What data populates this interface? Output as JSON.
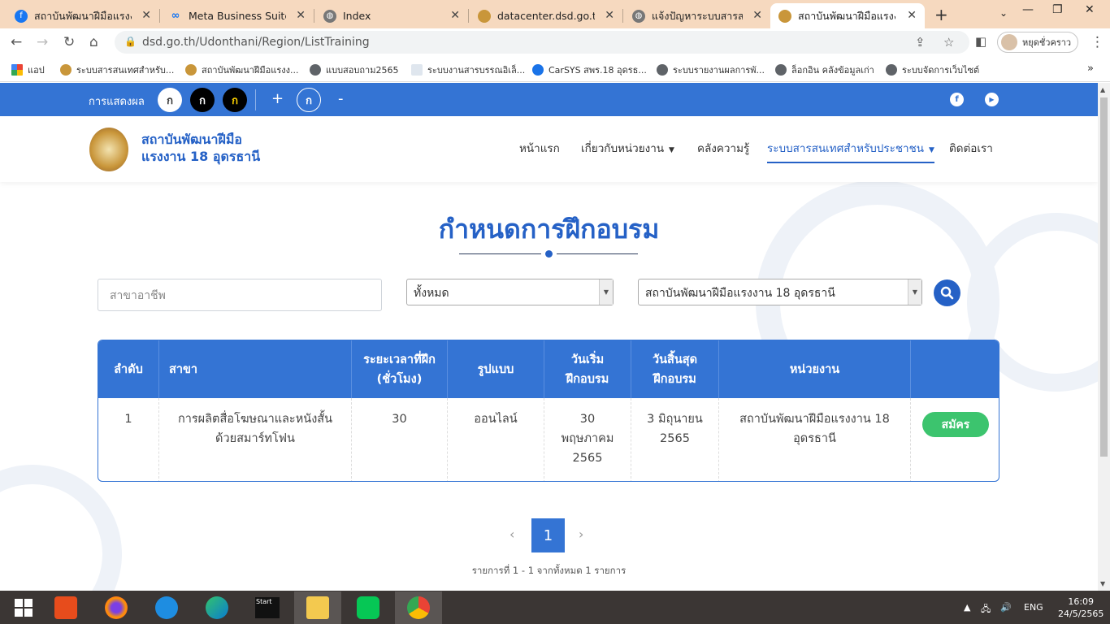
{
  "browser": {
    "tabs": [
      {
        "title": "สถาบันพัฒนาฝีมือแรงงาน",
        "icon": "facebook-icon"
      },
      {
        "title": "Meta Business Suite",
        "icon": "meta-icon"
      },
      {
        "title": "Index",
        "icon": "globe-icon"
      },
      {
        "title": "datacenter.dsd.go.th |",
        "icon": "dsd-seal-icon"
      },
      {
        "title": "แจ้งปัญหาระบบสารสนเทศ",
        "icon": "globe-icon"
      },
      {
        "title": "สถาบันพัฒนาฝีมือแรงงาน",
        "icon": "dsd-seal-icon"
      }
    ],
    "url": "dsd.go.th/Udonthani/Region/ListTraining",
    "profile_label": "หยุดชั่วคราว",
    "bookmarks": [
      "แอป",
      "ระบบสารสนเทศสำหรับ...",
      "สถาบันพัฒนาฝีมือแรงง...",
      "แบบสอบถาม2565",
      "ระบบงานสารบรรณอิเล็...",
      "CarSYS สพร.18 อุดรธ...",
      "ระบบรายงานผลการพั...",
      "ล็อกอิน คลังข้อมูลเก่า",
      "ระบบจัดการเว็บไซต์"
    ]
  },
  "topbar": {
    "display_label": "การแสดงผล",
    "font_buttons": [
      "ก",
      "ก",
      "ก"
    ],
    "plus": "+",
    "normal": "ก",
    "minus": "-"
  },
  "site": {
    "name_line1": "สถาบันพัฒนาฝีมือ",
    "name_line2": "แรงงาน 18 อุดรธานี"
  },
  "nav": {
    "home": "หน้าแรก",
    "about": "เกี่ยวกับหน่วยงาน",
    "knowledge": "คลังความรู้",
    "info_system": "ระบบสารสนเทศสำหรับประชาชน",
    "contact": "ติดต่อเรา"
  },
  "page_title": "กำหนดการฝึกอบรม",
  "filters": {
    "field_placeholder": "สาขาอาชีพ",
    "type_selected": "ทั้งหมด",
    "agency_selected": "สถาบันพัฒนาฝีมือแรงงาน 18 อุดรธานี"
  },
  "table": {
    "headers": {
      "no": "ลำดับ",
      "branch": "สาขา",
      "hours_l1": "ระยะเวลาที่ฝึก",
      "hours_l2": "(ชั่วโมง)",
      "mode": "รูปแบบ",
      "start_l1": "วันเริ่ม",
      "start_l2": "ฝึกอบรม",
      "end_l1": "วันสิ้นสุด",
      "end_l2": "ฝึกอบรม",
      "agency": "หน่วยงาน"
    },
    "rows": [
      {
        "no": "1",
        "branch_l1": "การผลิตสื่อโฆษณาและหนังสั้น",
        "branch_l2": "ด้วยสมาร์ทโฟน",
        "hours": "30",
        "mode": "ออนไลน์",
        "start_l1": "30",
        "start_l2": "พฤษภาคม",
        "start_l3": "2565",
        "end_l1": "3 มิถุนายน",
        "end_l2": "2565",
        "agency_l1": "สถาบันพัฒนาฝีมือแรงงาน 18",
        "agency_l2": "อุดรธานี",
        "action": "สมัคร"
      }
    ]
  },
  "pagination": {
    "current": "1",
    "summary": "รายการที่ 1 - 1 จากทั้งหมด 1 รายการ"
  },
  "taskbar": {
    "language": "ENG",
    "time": "16:09",
    "date": "24/5/2565",
    "start_app_label": "Start"
  },
  "colors": {
    "primary": "#3474d4",
    "title_blue": "#2561c6",
    "apply_green": "#3cc46e"
  }
}
